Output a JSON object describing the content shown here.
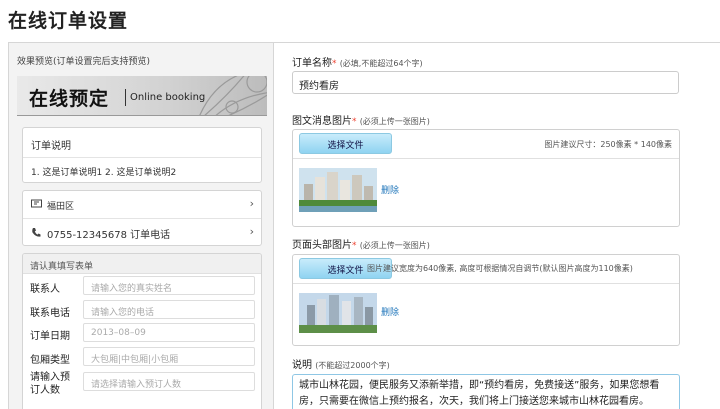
{
  "page": {
    "title": "在线订单设置"
  },
  "preview": {
    "caption": "效果预览(订单设置完后支持预览)",
    "banner_title": "在线预定",
    "banner_subtitle": "Online booking",
    "order_desc_title": "订单说明",
    "order_desc_text": "1. 这是订单说明1 2. 这是订单说明2",
    "location": "福田区",
    "phone": "0755-12345678 订单电话",
    "form_header": "请认真填写表单",
    "form_rows": [
      {
        "label": "联系人",
        "placeholder": "请输入您的真实姓名"
      },
      {
        "label": "联系电话",
        "placeholder": "请输入您的电话"
      },
      {
        "label": "订单日期",
        "placeholder": "2013–08–09"
      },
      {
        "label": "包厢类型",
        "placeholder": "大包厢|中包厢|小包厢"
      },
      {
        "label": "请输入预订人数",
        "placeholder": "请选择请输入预订人数"
      }
    ]
  },
  "settings": {
    "order_name_label": "订单名称",
    "required_mark": "*",
    "order_name_hint": "(必填,不能超过64个字)",
    "order_name_value": "预约看房",
    "msg_image_label": "图文消息图片",
    "msg_image_hint": "(必须上传一张图片)",
    "choose_file": "选择文件",
    "msg_image_size_hint": "图片建议尺寸：250像素 * 140像素",
    "delete_label": "删除",
    "header_image_label": "页面头部图片",
    "header_image_hint": "(必须上传一张图片)",
    "header_image_size_hint": "图片建议宽度为640像素, 高度可根据情况自调节(默认图片高度为110像素)",
    "description_label": "说明",
    "description_hint": "(不能超过2000个字)",
    "description_text": "城市山林花园，便民服务又添新举措，即“预约看房，免费接送”服务，如果您想看房，只需要在微信上预约报名，次天，我们将上门接送您来城市山林花园看房。"
  },
  "colors": {
    "accent_blue": "#8fd3f1",
    "link": "#2277bb",
    "required": "#ee4433"
  }
}
